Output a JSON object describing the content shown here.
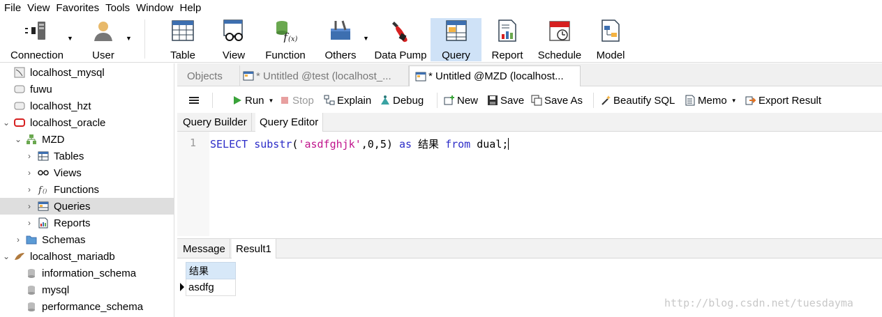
{
  "menu": [
    "File",
    "View",
    "Favorites",
    "Tools",
    "Window",
    "Help"
  ],
  "toolbar": {
    "connection": "Connection",
    "user": "User",
    "table": "Table",
    "view": "View",
    "function": "Function",
    "others": "Others",
    "data_pump": "Data Pump",
    "query": "Query",
    "report": "Report",
    "schedule": "Schedule",
    "model": "Model"
  },
  "sidebar": {
    "items": [
      {
        "label": "localhost_mysql"
      },
      {
        "label": "fuwu"
      },
      {
        "label": "localhost_hzt"
      },
      {
        "label": "localhost_oracle"
      },
      {
        "label": "MZD"
      },
      {
        "label": "Tables"
      },
      {
        "label": "Views"
      },
      {
        "label": "Functions"
      },
      {
        "label": "Queries"
      },
      {
        "label": "Reports"
      },
      {
        "label": "Schemas"
      },
      {
        "label": "localhost_mariadb"
      },
      {
        "label": "information_schema"
      },
      {
        "label": "mysql"
      },
      {
        "label": "performance_schema"
      }
    ]
  },
  "tabs": {
    "objects": "Objects",
    "tab1": "* Untitled @test (localhost_...",
    "tab2": "* Untitled @MZD (localhost..."
  },
  "qtoolbar": {
    "run": "Run",
    "stop": "Stop",
    "explain": "Explain",
    "debug": "Debug",
    "new": "New",
    "save": "Save",
    "save_as": "Save As",
    "beautify": "Beautify SQL",
    "memo": "Memo",
    "export": "Export Result"
  },
  "subtabs": {
    "builder": "Query Builder",
    "editor": "Query Editor"
  },
  "editor": {
    "line_number": "1",
    "t_select": "SELECT",
    "t_func": "substr",
    "t_open": "(",
    "t_str": "'asdfghjk'",
    "t_args": ",0,5)",
    "t_as": "as",
    "t_alias": "结果",
    "t_from": "from",
    "t_table": "dual;"
  },
  "results": {
    "tab_message": "Message",
    "tab_result": "Result1",
    "column": "结果",
    "value": "asdfg"
  },
  "watermark": "http://blog.csdn.net/tuesdayma",
  "colors": {
    "keyword": "#2c2cc8",
    "string": "#c0148c",
    "selection": "#cfe2f7"
  }
}
